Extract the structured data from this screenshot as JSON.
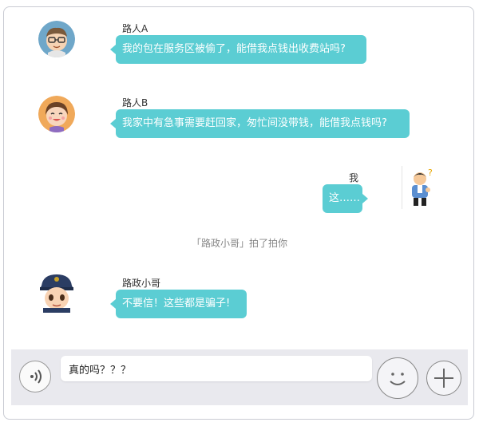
{
  "messages": [
    {
      "sender": "路人A",
      "text": "我的包在服务区被偷了，能借我点钱出收费站吗?",
      "side": "left",
      "avatar": "old-man-with-glasses-icon"
    },
    {
      "sender": "路人B",
      "text": "我家中有急事需要赶回家，匆忙间没带钱，能借我点钱吗?",
      "side": "left",
      "avatar": "smiling-woman-icon"
    },
    {
      "sender": "我",
      "text": "这……",
      "side": "right",
      "avatar": "confused-man-icon"
    },
    {
      "sender": "路政小哥",
      "text": "不要信！这些都是骗子!",
      "side": "left",
      "avatar": "officer-boy-icon"
    }
  ],
  "system_notice": "「路政小哥」拍了拍你",
  "input": {
    "value": "真的吗？？？"
  },
  "colors": {
    "bubble": "#5bcdd3",
    "input_bar": "#e9e9ee"
  }
}
